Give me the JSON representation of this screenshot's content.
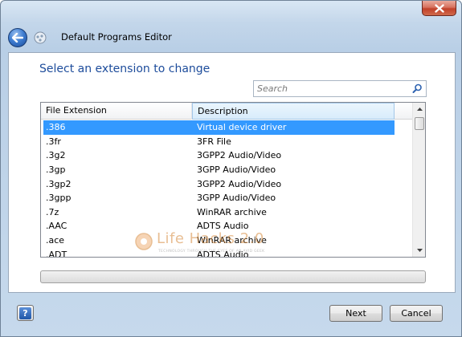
{
  "window": {
    "title": "Default Programs Editor",
    "close_icon": "close-icon"
  },
  "content": {
    "heading": "Select an extension to change",
    "search": {
      "placeholder": "Search",
      "value": ""
    }
  },
  "list": {
    "columns": [
      "File Extension",
      "Description"
    ],
    "selected_index": 0,
    "rows": [
      {
        "ext": ".386",
        "desc": "Virtual device driver"
      },
      {
        "ext": ".3fr",
        "desc": "3FR File"
      },
      {
        "ext": ".3g2",
        "desc": "3GPP2 Audio/Video"
      },
      {
        "ext": ".3gp",
        "desc": "3GPP Audio/Video"
      },
      {
        "ext": ".3gp2",
        "desc": "3GPP2 Audio/Video"
      },
      {
        "ext": ".3gpp",
        "desc": "3GPP Audio/Video"
      },
      {
        "ext": ".7z",
        "desc": "WinRAR archive"
      },
      {
        "ext": ".AAC",
        "desc": "ADTS Audio"
      },
      {
        "ext": ".ace",
        "desc": "WinRAR archive"
      },
      {
        "ext": ".ADT",
        "desc": "ADTS Audio"
      }
    ]
  },
  "watermark": {
    "text": "Life Hacks 2.0",
    "tagline": "TECHNOLOGY THROUGH THE EYES OF AN AVID GEEK"
  },
  "footer": {
    "help_label": "?",
    "next_label": "Next",
    "cancel_label": "Cancel"
  },
  "colors": {
    "heading": "#1d4c9b",
    "selection": "#3399ff",
    "frame": "#c3d6ea"
  }
}
